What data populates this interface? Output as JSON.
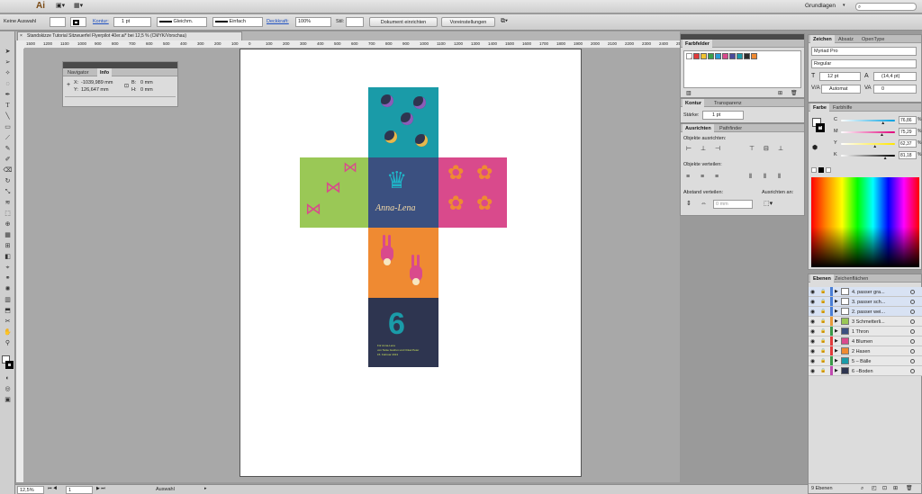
{
  "app": {
    "logo": "Ai",
    "workspace": "Grundlagen"
  },
  "control_bar": {
    "selection": "Keine Auswahl",
    "stroke_label": "Kontur:",
    "stroke_value": "1 pt",
    "profile": "Gleichm.",
    "brush": "Einfach",
    "opacity_label": "Deckkraft:",
    "opacity_value": "100%",
    "style_label": "Stil:",
    "doc_setup": "Dokument einrichten",
    "preferences": "Voreinstellungen"
  },
  "document_tab": "Standskizze Tutorial Sitzwuerfel Flyerpilot 40er.ai* bei 12,5 % (CMYK/Vorschau)",
  "ruler": {
    "ticks": [
      "1500",
      "1200",
      "1100",
      "1000",
      "900",
      "800",
      "700",
      "600",
      "500",
      "400",
      "300",
      "200",
      "100",
      "0",
      "100",
      "200",
      "300",
      "400",
      "500",
      "600",
      "700",
      "800",
      "900",
      "1000",
      "1100",
      "1200",
      "1300",
      "1400",
      "1500",
      "1600",
      "1700",
      "1800",
      "1900",
      "2000",
      "2100",
      "2200",
      "2300",
      "2400",
      "2500"
    ]
  },
  "navigator_panel": {
    "tabs": [
      "Navigator",
      "Info"
    ],
    "x_label": "X:",
    "x_value": "-1039,989 mm",
    "y_label": "Y:",
    "y_value": "126,647 mm",
    "b_label": "B:",
    "b_value": "0 mm",
    "h_label": "H:",
    "h_value": "0 mm"
  },
  "artwork": {
    "name_text": "Anna-Lena",
    "number": "6",
    "small_lines": [
      "Für Anna-Lena",
      "von Tante Gudrun und Onkel Peter",
      "15. Februar 2013"
    ],
    "colors": {
      "teal": "#1a9ba8",
      "green": "#9ac856",
      "navy": "#3b5080",
      "pink": "#d94a8c",
      "orange": "#ef8a32",
      "dark": "#2e3550"
    }
  },
  "swatches_panel": {
    "title": "Farbfelder",
    "colors": [
      "#e23a3a",
      "#f2c230",
      "#3aa14b",
      "#2a9bd7",
      "#d94a8c",
      "#4b4b9b",
      "#1a9ba8",
      "#2c2c2c",
      "#ef8a32"
    ]
  },
  "stroke_panel": {
    "tabs": [
      "Kontur",
      "Transparenz"
    ],
    "weight_label": "Stärke:",
    "weight_value": "1 pt"
  },
  "align_panel": {
    "tabs": [
      "Ausrichten",
      "Pathfinder"
    ],
    "align_objects": "Objekte ausrichten:",
    "distribute_objects": "Objekte verteilen:",
    "distribute_spacing": "Abstand verteilen:",
    "align_to": "Ausrichten an:",
    "spacing_value": "0 mm"
  },
  "character_panel": {
    "tabs": [
      "Zeichen",
      "Absatz",
      "OpenType"
    ],
    "font": "Myriad Pro",
    "style": "Regular",
    "size": "12 pt",
    "leading": "(14,4 pt)",
    "kerning": "Automat",
    "tracking": "0"
  },
  "color_panel": {
    "tabs": [
      "Farbe",
      "Farbhilfe"
    ],
    "channels": [
      {
        "label": "C",
        "value": "76,86",
        "unit": "%",
        "pos": 0.77
      },
      {
        "label": "M",
        "value": "75,29",
        "unit": "%",
        "pos": 0.75
      },
      {
        "label": "Y",
        "value": "62,37",
        "unit": "%",
        "pos": 0.62
      },
      {
        "label": "K",
        "value": "81,18",
        "unit": "%",
        "pos": 0.81
      }
    ]
  },
  "layers_panel": {
    "tabs": [
      "Ebenen",
      "Zeichenflächen"
    ],
    "layers": [
      {
        "name": "4. passer gra...",
        "color": "#4a7fd6",
        "thumb": "#ffffff"
      },
      {
        "name": "3. passer sch...",
        "color": "#4a7fd6",
        "thumb": "#ffffff"
      },
      {
        "name": "2. passer wei...",
        "color": "#4a7fd6",
        "thumb": "#ffffff"
      },
      {
        "name": "3 Schmetterli...",
        "color": "#e89a3a",
        "thumb": "#9ac856"
      },
      {
        "name": "1 Thron",
        "color": "#3a9a4a",
        "thumb": "#3b5080"
      },
      {
        "name": "4 Blumen",
        "color": "#e23a3a",
        "thumb": "#d94a8c"
      },
      {
        "name": "2 Hasen",
        "color": "#e23a3a",
        "thumb": "#ef8a32"
      },
      {
        "name": "5 – Bälle",
        "color": "#3a9a4a",
        "thumb": "#1a9ba8"
      },
      {
        "name": "6 –Boden",
        "color": "#c04ab0",
        "thumb": "#2e3550"
      }
    ],
    "count": "9 Ebenen"
  },
  "status_bar": {
    "zoom": "12,5%",
    "page": "1",
    "mode": "Auswahl"
  }
}
